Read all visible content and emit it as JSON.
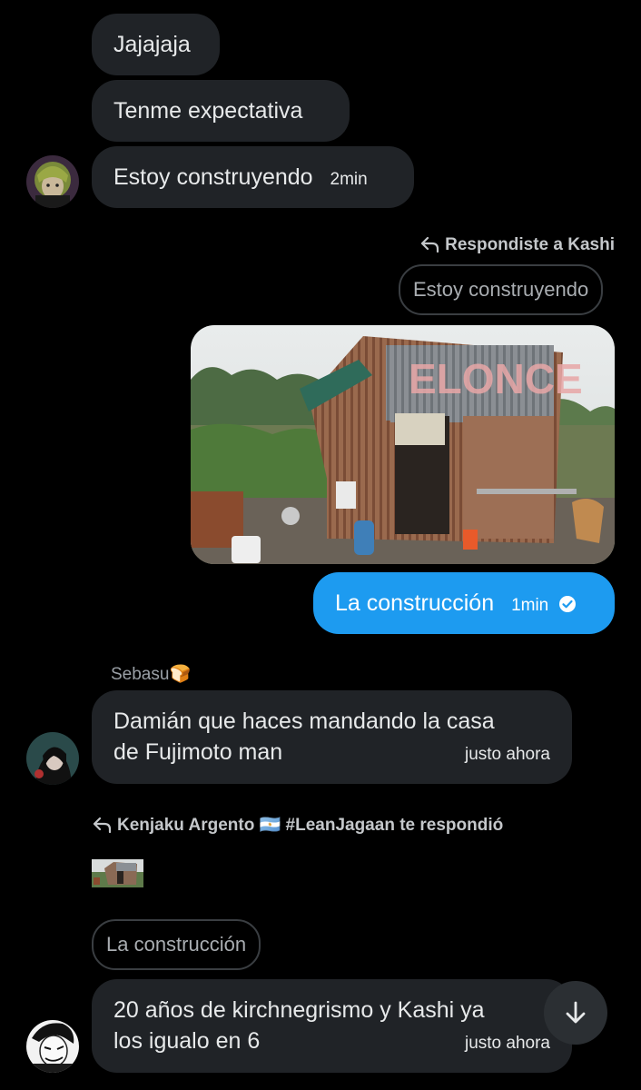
{
  "messages": {
    "m1": "Jajajaja",
    "m2": "Tenme expectativa",
    "m3": {
      "text": "Estoy construyendo",
      "time": "2min"
    },
    "reply1": {
      "label": "Respondiste a Kashi",
      "quoted": "Estoy construyendo"
    },
    "own": {
      "text": "La construcción",
      "time": "1min",
      "watermark": "ELONCE"
    },
    "sebasu": {
      "sender": "Sebasu",
      "sender_emoji": "🍞",
      "text_line1": "Damián que haces mandando la casa",
      "text_line2": "de Fujimoto man",
      "time": "justo ahora"
    },
    "reply2": {
      "label": "Kenjaku Argento 🇦🇷 #LeanJagaan te respondió",
      "quoted": "La construcción"
    },
    "last": {
      "text_line1": "20 años de kirchnegrismo y Kashi ya",
      "text_line2": "los igualo en 6",
      "time": "justo ahora"
    }
  },
  "colors": {
    "own_bubble": "#1d9bf0",
    "other_bubble": "#202327",
    "background": "#000000"
  },
  "icons": {
    "reply": "reply-arrow-icon",
    "read": "check-circle-icon",
    "scroll": "arrow-down-icon"
  }
}
